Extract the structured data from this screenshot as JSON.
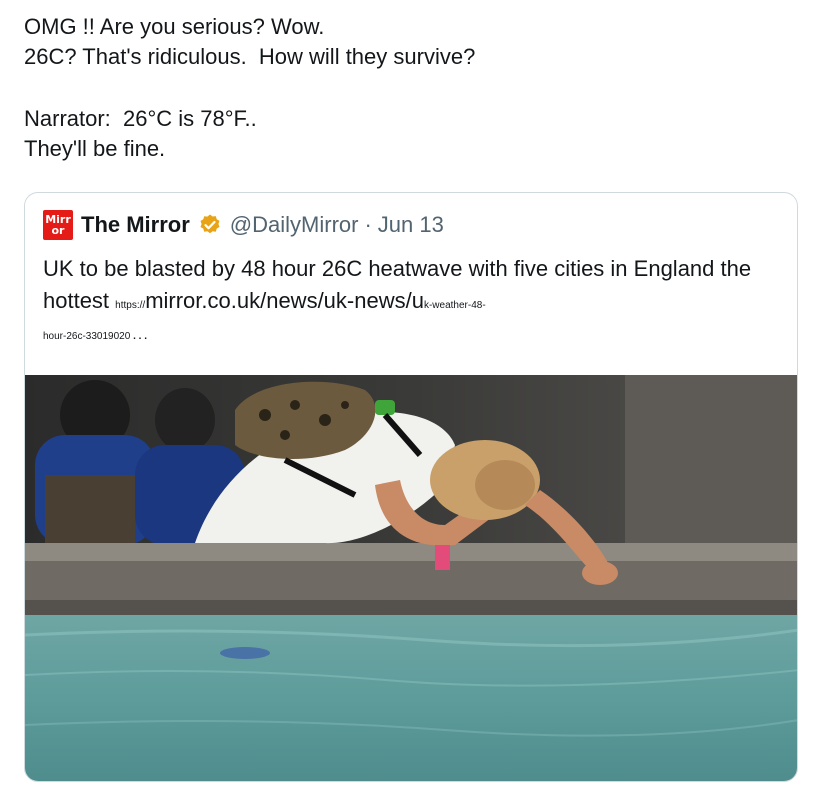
{
  "tweet": {
    "lines": [
      "OMG !! Are you serious? Wow.",
      "26C? That's ridiculous.  How will they survive?",
      "",
      "Narrator:  26°C is 78°F..",
      "They'll be fine."
    ]
  },
  "quoted_tweet": {
    "logo_text_top": "Mirr",
    "logo_text_bottom": "or",
    "display_name": "The Mirror",
    "handle": "@DailyMirror",
    "separator": "·",
    "date": "Jun 13",
    "headline": "UK to be blasted by 48 hour 26C heatwave with five cities in England the hottest",
    "link_prefix": "https://",
    "link_main": "mirror.co.uk/news/uk-news/u",
    "link_tail_1": "k-weather-48-",
    "link_tail_2": "hour-26c-33019020",
    "link_ellipsis": " . . .",
    "colors": {
      "logo_red": "#e41b17",
      "verified_gold": "#e8a317",
      "muted_text": "#536471"
    },
    "media": {
      "icon": "photo-heatwave-woman-fountain"
    }
  }
}
